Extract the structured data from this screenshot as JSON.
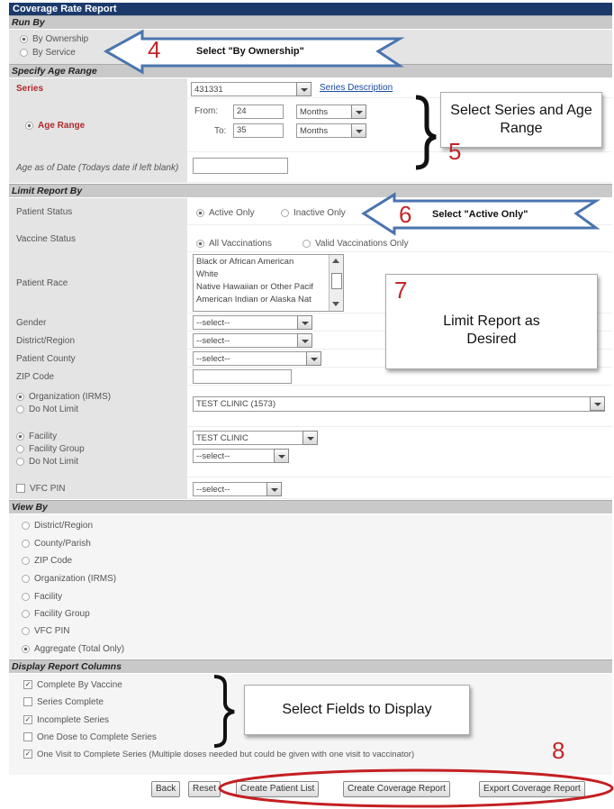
{
  "title": "Coverage Rate Report",
  "sections": {
    "run_by": "Run By",
    "age_range": "Specify Age Range",
    "limit": "Limit Report By",
    "view_by": "View By",
    "display": "Display Report Columns"
  },
  "run_by": {
    "by_ownership": "By Ownership",
    "by_service": "By Service"
  },
  "age": {
    "series_label": "Series",
    "series_value": "431331",
    "series_link": "Series Description",
    "age_range_label": "Age Range",
    "from_label": "From:",
    "from_value": "24",
    "to_label": "To:",
    "to_value": "35",
    "unit_from": "Months",
    "unit_to": "Months",
    "age_as_of_label": "Age as of Date (Todays date if left blank)",
    "age_as_of_value": ""
  },
  "limit": {
    "patient_status_label": "Patient Status",
    "active_only": "Active Only",
    "inactive_only": "Inactive Only",
    "vaccine_status_label": "Vaccine Status",
    "all_vaccinations": "All Vaccinations",
    "valid_vaccinations": "Valid Vaccinations Only",
    "patient_race_label": "Patient Race",
    "race_options": [
      "Black or African American",
      "White",
      "Native Hawaiian or Other Pacif",
      "American Indian or Alaska Nat"
    ],
    "gender_label": "Gender",
    "gender_value": "--select--",
    "district_label": "District/Region",
    "district_value": "--select--",
    "county_label": "Patient County",
    "county_value": "--select--",
    "zip_label": "ZIP Code",
    "zip_value": "",
    "org_label": "Organization (IRMS)",
    "org_value": "TEST CLINIC (1573)",
    "do_not_limit": "Do Not Limit",
    "facility_label": "Facility",
    "facility_value": "TEST CLINIC",
    "facility_group_label": "Facility Group",
    "facility_group_value": "--select--",
    "do_not_limit2": "Do Not Limit",
    "vfc_label": "VFC PIN",
    "vfc_value": "--select--"
  },
  "view_by": [
    "District/Region",
    "County/Parish",
    "ZIP Code",
    "Organization (IRMS)",
    "Facility",
    "Facility Group",
    "VFC PIN",
    "Aggregate (Total Only)"
  ],
  "display": {
    "complete_by_vaccine": "Complete By Vaccine",
    "series_complete": "Series Complete",
    "incomplete_series": "Incomplete Series",
    "one_dose": "One Dose to Complete Series",
    "one_visit": "One Visit to Complete Series (Multiple doses needed but could be given with one visit to vaccinator)"
  },
  "buttons": {
    "back": "Back",
    "reset": "Reset",
    "patient_list": "Create Patient List",
    "coverage_report": "Create Coverage Report",
    "export": "Export Coverage Report"
  },
  "annotations": {
    "n4": "4",
    "t4": "Select \"By Ownership\"",
    "n5": "5",
    "t5": "Select Series and Age Range",
    "n6": "6",
    "t6": "Select \"Active Only\"",
    "n7": "7",
    "t7": "Limit Report as Desired",
    "t_fields": "Select Fields to Display",
    "n8": "8"
  },
  "colors": {
    "title_bar": "#1b3a6b",
    "section": "#c9c9c9",
    "label_bg": "#e4e4e4",
    "accent_red": "#c0282a",
    "label_red": "#b02a2a"
  }
}
